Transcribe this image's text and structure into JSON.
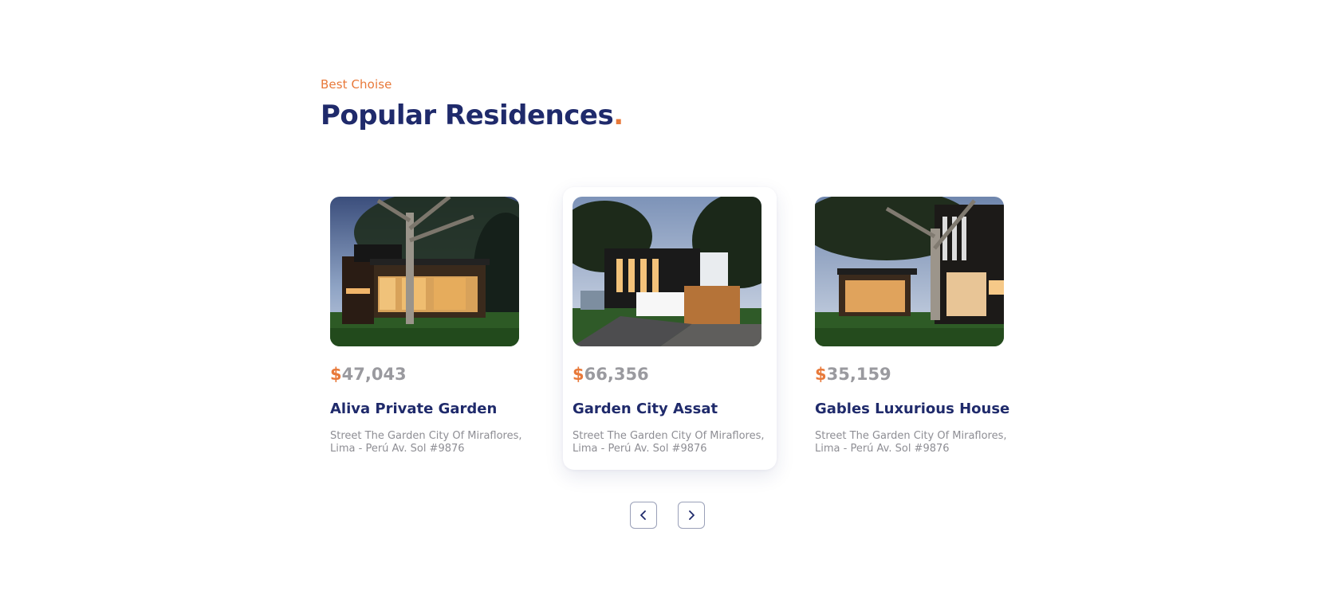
{
  "section": {
    "subtitle": "Best Choise",
    "title": "Popular Residences",
    "title_dot": "."
  },
  "cards": [
    {
      "currency": "$",
      "price": "47,043",
      "name": "Aliva Private Garden",
      "address": "Street The Garden City Of Miraflores, Lima - Perú Av. Sol #9876",
      "active": false
    },
    {
      "currency": "$",
      "price": "66,356",
      "name": "Garden City Assat",
      "address": "Street The Garden City Of Miraflores, Lima - Perú Av. Sol #9876",
      "active": true
    },
    {
      "currency": "$",
      "price": "35,159",
      "name": "Gables Luxurious House",
      "address": "Street The Garden City Of Miraflores, Lima - Perú Av. Sol #9876",
      "active": false
    }
  ],
  "navigation": {
    "prev_icon": "chevron-left-icon",
    "next_icon": "chevron-right-icon"
  },
  "colors": {
    "accent": "#e8793a",
    "heading": "#1f2a6b",
    "muted": "#8e8e94",
    "price_gray": "#9a9a9f"
  }
}
